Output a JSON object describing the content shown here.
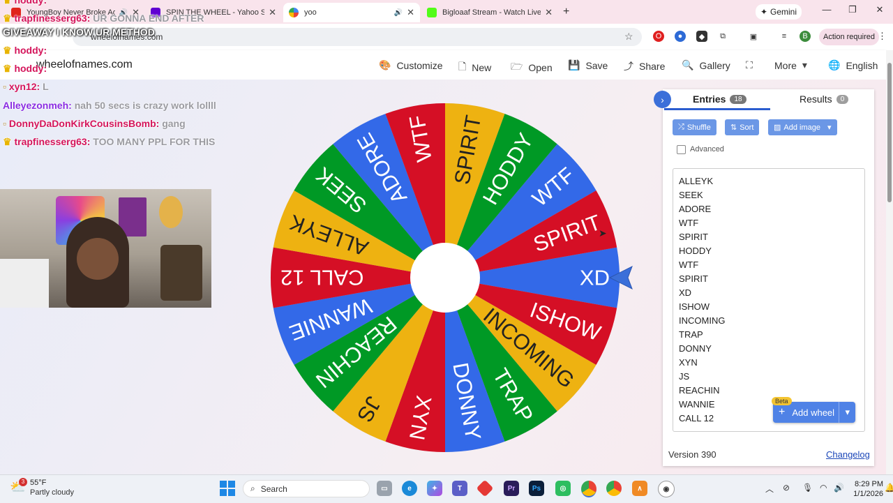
{
  "browser": {
    "tabs": [
      {
        "title": "YoungBoy Never Broke Again",
        "favicon_color": "#e0231b"
      },
      {
        "title": "SPIN THE WHEEL - Yahoo Search",
        "favicon_color": "#6001d2"
      },
      {
        "title": "yoo",
        "favicon_color": "#4285f4"
      },
      {
        "title": "Bigloaaf Stream - Watch Live on Kick",
        "favicon_color": "#53fc18"
      }
    ],
    "new_tab": "+",
    "gemini_label": "Gemini",
    "url": "wheelofnames.com",
    "profile_initial": "B",
    "action_required": "Action required",
    "window_controls": [
      "—",
      "❐",
      "✕"
    ]
  },
  "site": {
    "logo_text": "wheelofnames.com",
    "nav": [
      {
        "label": "Customize",
        "icon": "palette-icon",
        "glyph": "🎨"
      },
      {
        "label": "New",
        "icon": "file-icon",
        "glyph": "🗋"
      },
      {
        "label": "Open",
        "icon": "folder-icon",
        "glyph": "🗁"
      },
      {
        "label": "Save",
        "icon": "save-icon",
        "glyph": "💾"
      },
      {
        "label": "Share",
        "icon": "share-icon",
        "glyph": "⤴"
      },
      {
        "label": "Gallery",
        "icon": "search-icon",
        "glyph": "🔍"
      },
      {
        "label": "",
        "icon": "fullscreen-icon",
        "glyph": "⛶"
      },
      {
        "label": "More",
        "icon": "chevron-down-icon",
        "glyph": "▾"
      },
      {
        "label": "English",
        "icon": "globe-icon",
        "glyph": "🌐"
      }
    ]
  },
  "wheel": {
    "colors": [
      "#3369e8",
      "#d50f25",
      "#eeb211",
      "#009925"
    ],
    "segments": [
      "XD",
      "ISHOW",
      "INCOMING",
      "TRAP",
      "DONNY",
      "XYN",
      "JS",
      "REACHIN",
      "WANNIE",
      "CALL 12",
      "ALLEYK",
      "SEEK",
      "ADORE",
      "WTF",
      "SPIRIT",
      "HODDY",
      "WTF",
      "SPIRIT"
    ]
  },
  "panel": {
    "tabs": [
      {
        "label": "Entries",
        "count": "18"
      },
      {
        "label": "Results",
        "count": "0"
      }
    ],
    "tools": {
      "shuffle": "Shuffle",
      "sort": "Sort",
      "add_image": "Add image"
    },
    "advanced_label": "Advanced",
    "entries": [
      "ALLEYK",
      "SEEK",
      "ADORE",
      "WTF",
      "SPIRIT",
      "HODDY",
      "WTF",
      "SPIRIT",
      "XD",
      "ISHOW",
      "INCOMING",
      "TRAP",
      "DONNY",
      "XYN",
      "JS",
      "REACHIN",
      "WANNIE",
      "CALL 12"
    ],
    "beta_label": "Beta",
    "add_wheel_label": "Add wheel",
    "version": "Version 390",
    "changelog": "Changelog"
  },
  "stream_overlay": {
    "chat": [
      {
        "user": "hoddy:",
        "msg": "",
        "color": "#d4145a"
      },
      {
        "user": "trapfinesserg63:",
        "msg": "UR GONNA END AFTER",
        "color": "#d4145a"
      },
      {
        "user": "hoddy:",
        "msg": "",
        "color": "#d4145a"
      },
      {
        "user": "hoddy:",
        "msg": "",
        "color": "#d4145a"
      },
      {
        "user": "xyn12:",
        "msg": "L",
        "color": "#d4145a"
      },
      {
        "user": "Alleyezonmeh:",
        "msg": "nah 50 secs is crazy work lollll",
        "color": "#8a2be2"
      },
      {
        "user": "DonnyDaDonKirkCousinsBomb:",
        "msg": "gang",
        "color": "#d4145a"
      },
      {
        "user": "trapfinesserg63:",
        "msg": "TOO MANY PPL FOR THIS",
        "color": "#d4145a"
      }
    ],
    "overlay_line": "GIVEAWAY I KNOW UR METHOD"
  },
  "taskbar": {
    "weather_temp": "55°F",
    "weather_desc": "Partly cloudy",
    "weather_badge": "3",
    "search_placeholder": "Search",
    "time": "8:29 PM",
    "date": "1/1/2026"
  }
}
